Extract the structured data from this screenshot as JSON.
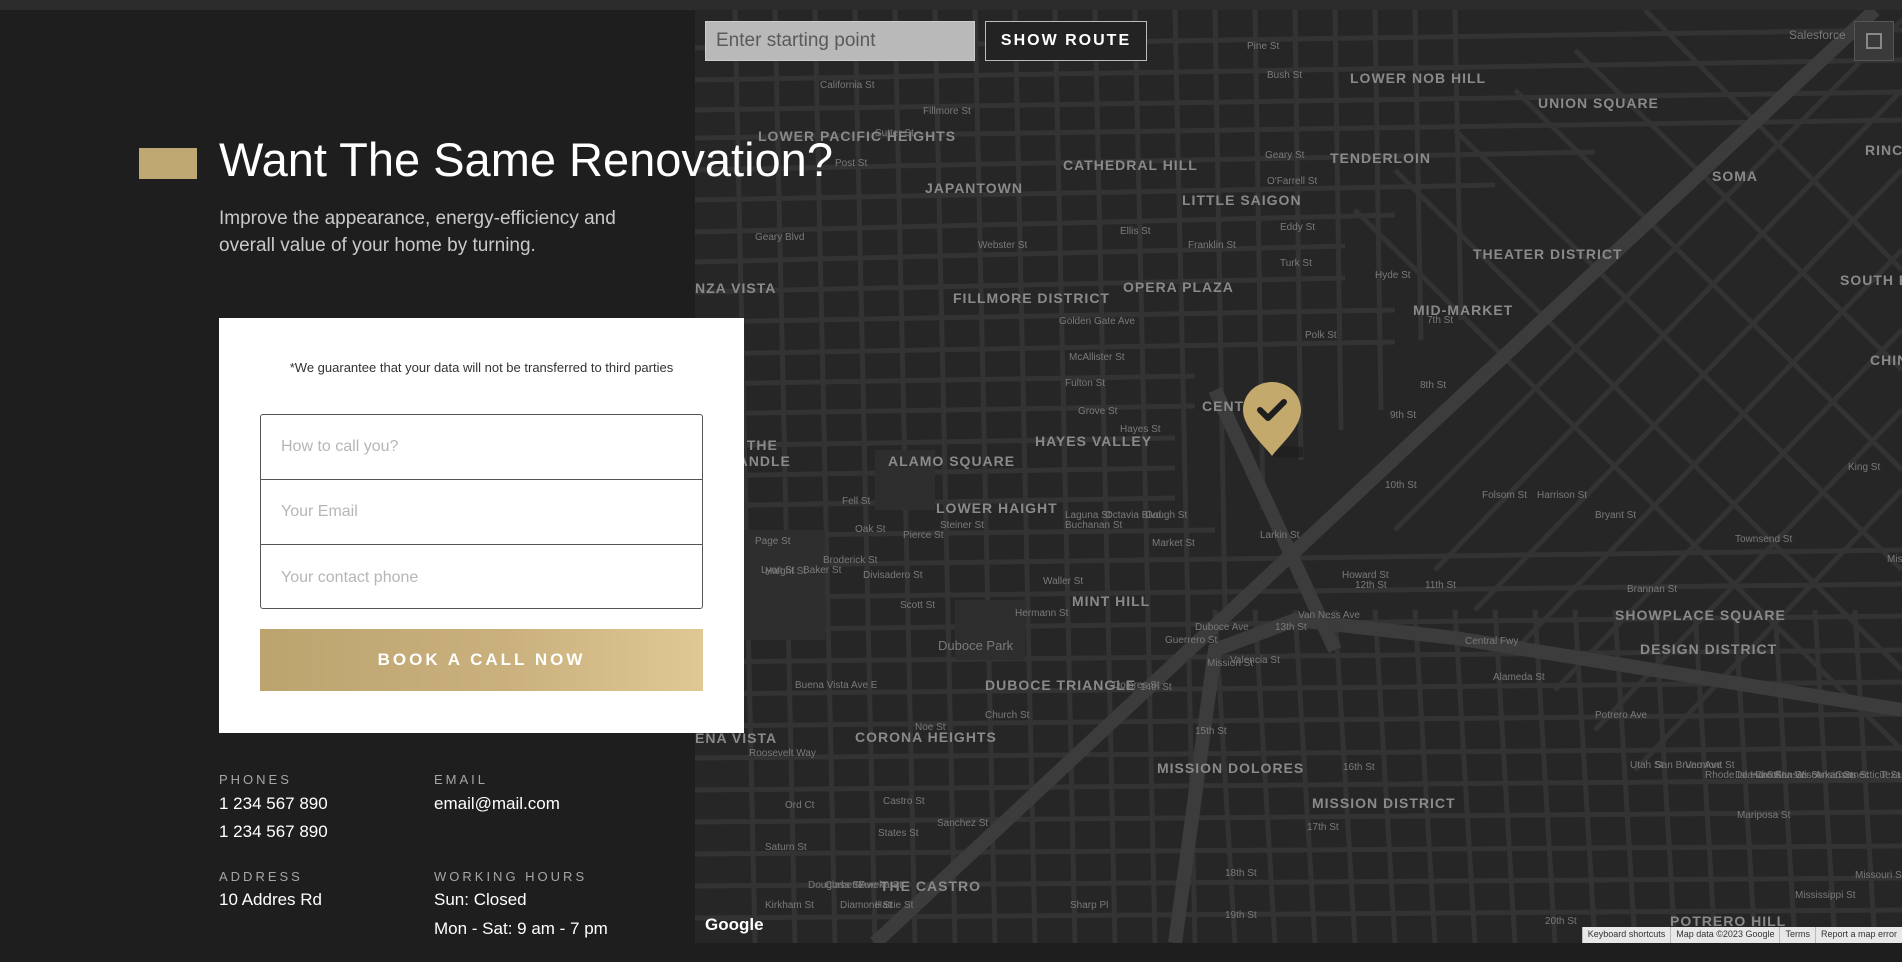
{
  "hero": {
    "title": "Want The Same Renovation?",
    "subtitle": "Improve the appearance, energy-efficiency and overall value of your home by turning."
  },
  "form": {
    "guarantee": "*We guarantee that your data will not be transferred to third parties",
    "name_placeholder": "How to call you?",
    "email_placeholder": "Your Email",
    "phone_placeholder": "Your contact phone",
    "submit_label": "BOOK A CALL NOW"
  },
  "contacts": {
    "phones_label": "PHONES",
    "phones": [
      "1 234 567 890",
      "1 234 567 890"
    ],
    "email_label": "EMAIL",
    "email": "email@mail.com",
    "address_label": "ADDRESS",
    "address": "10 Addres Rd",
    "hours_label": "WORKING HOURS",
    "hours": [
      "Sun: Closed",
      "Mon - Sat: 9 am - 7 pm"
    ]
  },
  "map": {
    "route_placeholder": "Enter starting point",
    "route_button": "SHOW ROUTE",
    "google": "Google",
    "footer": [
      "Keyboard shortcuts",
      "Map data ©2023 Google",
      "Terms",
      "Report a map error"
    ],
    "districts": [
      "LOWER NOB HILL",
      "UNION SQUARE",
      "LOWER PACIFIC HEIGHTS",
      "CATHEDRAL HILL",
      "TENDERLOIN",
      "JAPANTOWN",
      "LITTLE SAIGON",
      "SOMA",
      "THEATER DISTRICT",
      "OPERA PLAZA",
      "MID-MARKET",
      "FILLMORE DISTRICT",
      "HAYES VALLEY",
      "ALAMO SQUARE",
      "LOWER HAIGHT",
      "MINT HILL",
      "DUBOCE TRIANGLE",
      "CORONA HEIGHTS",
      "MISSION DOLORES",
      "MISSION DISTRICT",
      "SHOWPLACE SQUARE",
      "DESIGN DISTRICT",
      "THE CASTRO",
      "POTRERO HILL",
      "SOUTH B",
      "CHIN",
      "RINC",
      "NZA VISTA",
      "TH OF THE PANHANDLE",
      "ENA VISTA",
      "CENTER"
    ],
    "streets": [
      "Pine St",
      "Bush St",
      "California St",
      "Sutter St",
      "Post St",
      "Geary St",
      "Geary Blvd",
      "O'Farrell St",
      "Eddy St",
      "Turk St",
      "Ellis St",
      "Golden Gate Ave",
      "McAllister St",
      "Fulton St",
      "Grove St",
      "Hayes St",
      "Fell St",
      "Oak St",
      "Page St",
      "Haight St",
      "Waller St",
      "Hermann St",
      "Duboce Ave",
      "Duboce Park",
      "14th St",
      "15th St",
      "16th St",
      "17th St",
      "18th St",
      "19th St",
      "20th St",
      "Market St",
      "Mission St",
      "Howard St",
      "Folsom St",
      "Harrison St",
      "Bryant St",
      "Brannan St",
      "Townsend St",
      "King St",
      "Central Fwy",
      "Alameda St",
      "Mariposa St",
      "Valencia St",
      "Guerrero St",
      "Dolores St",
      "Church St",
      "Sanchez St",
      "Noe St",
      "Castro St",
      "Divisadero St",
      "Scott St",
      "Pierce St",
      "Steiner St",
      "Fillmore St",
      "Webster St",
      "Buchanan St",
      "Laguna St",
      "Octavia Blvd",
      "Gough St",
      "Franklin St",
      "Van Ness Ave",
      "Polk St",
      "Larkin St",
      "Hyde St",
      "9th St",
      "10th St",
      "11th St",
      "12th St",
      "13th St",
      "7th St",
      "8th St",
      "Salesforce",
      "Roosevelt Way",
      "Buena Vista Ave E",
      "Lyon St",
      "Baker St",
      "Broderick St",
      "Potrero Ave",
      "Utah St",
      "San Bruno Ave",
      "Vermont St",
      "Kansas St",
      "Rhode Island St",
      "De Haro St",
      "Carolina St",
      "Wisconsin St",
      "Arkansas St",
      "Connecticut St",
      "Missouri St",
      "Texas St",
      "Mississippi St",
      "Kirkham St",
      "States St",
      "Ord Ct",
      "Saturn St",
      "Corbett Ave",
      "Eureka St",
      "Douglass St",
      "Diamond St",
      "Hattie St",
      "Sharp Pl",
      "Mission"
    ]
  }
}
